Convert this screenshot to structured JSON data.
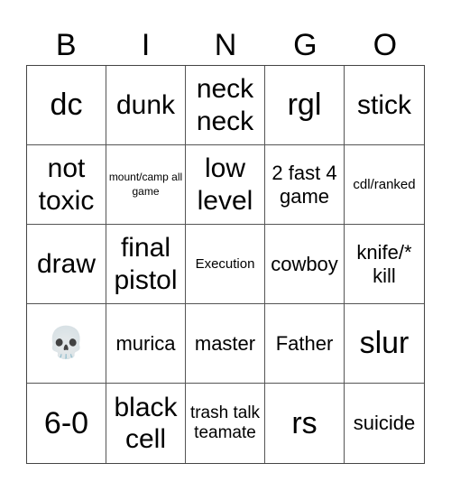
{
  "card": {
    "header": [
      "B",
      "I",
      "N",
      "G",
      "O"
    ],
    "cells": [
      {
        "text": "dc",
        "size": "fs-xl"
      },
      {
        "text": "dunk",
        "size": "fs-l"
      },
      {
        "text": "neck neck",
        "size": "fs-l"
      },
      {
        "text": "rgl",
        "size": "fs-xl"
      },
      {
        "text": "stick",
        "size": "fs-l"
      },
      {
        "text": "not toxic",
        "size": "fs-l"
      },
      {
        "text": "mount/camp all game",
        "size": "fs-xxs"
      },
      {
        "text": "low level",
        "size": "fs-l"
      },
      {
        "text": "2 fast 4 game",
        "size": "fs-m"
      },
      {
        "text": "cdl/ranked",
        "size": "fs-xs"
      },
      {
        "text": "draw",
        "size": "fs-l"
      },
      {
        "text": "final pistol",
        "size": "fs-l"
      },
      {
        "text": "Execution",
        "size": "fs-xs"
      },
      {
        "text": "cowboy",
        "size": "fs-m"
      },
      {
        "text": "knife/* kill",
        "size": "fs-m"
      },
      {
        "text": "💀",
        "size": "emoji",
        "icon": "skull-icon"
      },
      {
        "text": "murica",
        "size": "fs-m"
      },
      {
        "text": "master",
        "size": "fs-m"
      },
      {
        "text": "Father",
        "size": "fs-m"
      },
      {
        "text": "slur",
        "size": "fs-xl"
      },
      {
        "text": "6-0",
        "size": "fs-xl"
      },
      {
        "text": "black cell",
        "size": "fs-l"
      },
      {
        "text": "trash talk teamate",
        "size": "fs-s"
      },
      {
        "text": "rs",
        "size": "fs-xl"
      },
      {
        "text": "suicide",
        "size": "fs-m"
      }
    ]
  },
  "colors": {
    "background": "#ffffff",
    "grid_line": "#555555",
    "text": "#000000"
  }
}
